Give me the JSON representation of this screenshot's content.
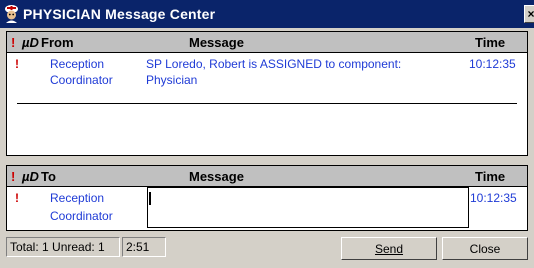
{
  "window": {
    "title": "PHYSICIAN Message Center",
    "close_label": "×"
  },
  "received": {
    "headers": {
      "flag": "!",
      "attach": "µD",
      "from": "From",
      "message": "Message",
      "time": "Time"
    },
    "rows": [
      {
        "flag": "!",
        "from_line1": "Reception",
        "from_line2": "Coordinator",
        "message_line1": "SP Loredo, Robert  is ASSIGNED to component:",
        "message_line2": "Physician",
        "time": "10:12:35"
      }
    ]
  },
  "compose": {
    "headers": {
      "flag": "!",
      "attach": "µD",
      "to": "To",
      "message": "Message",
      "time": "Time"
    },
    "row": {
      "flag": "!",
      "to_line1": "Reception",
      "to_line2": "Coordinator",
      "message_value": "",
      "time": "10:12:35"
    }
  },
  "status": {
    "counts": "Total: 1 Unread: 1",
    "clock": "2:51",
    "send_label": "Send",
    "close_label": "Close"
  },
  "colors": {
    "titlebar": "#0a246a",
    "link_text": "#1f3bd6",
    "flag": "#cc0000",
    "chrome": "#d4d0c8"
  }
}
